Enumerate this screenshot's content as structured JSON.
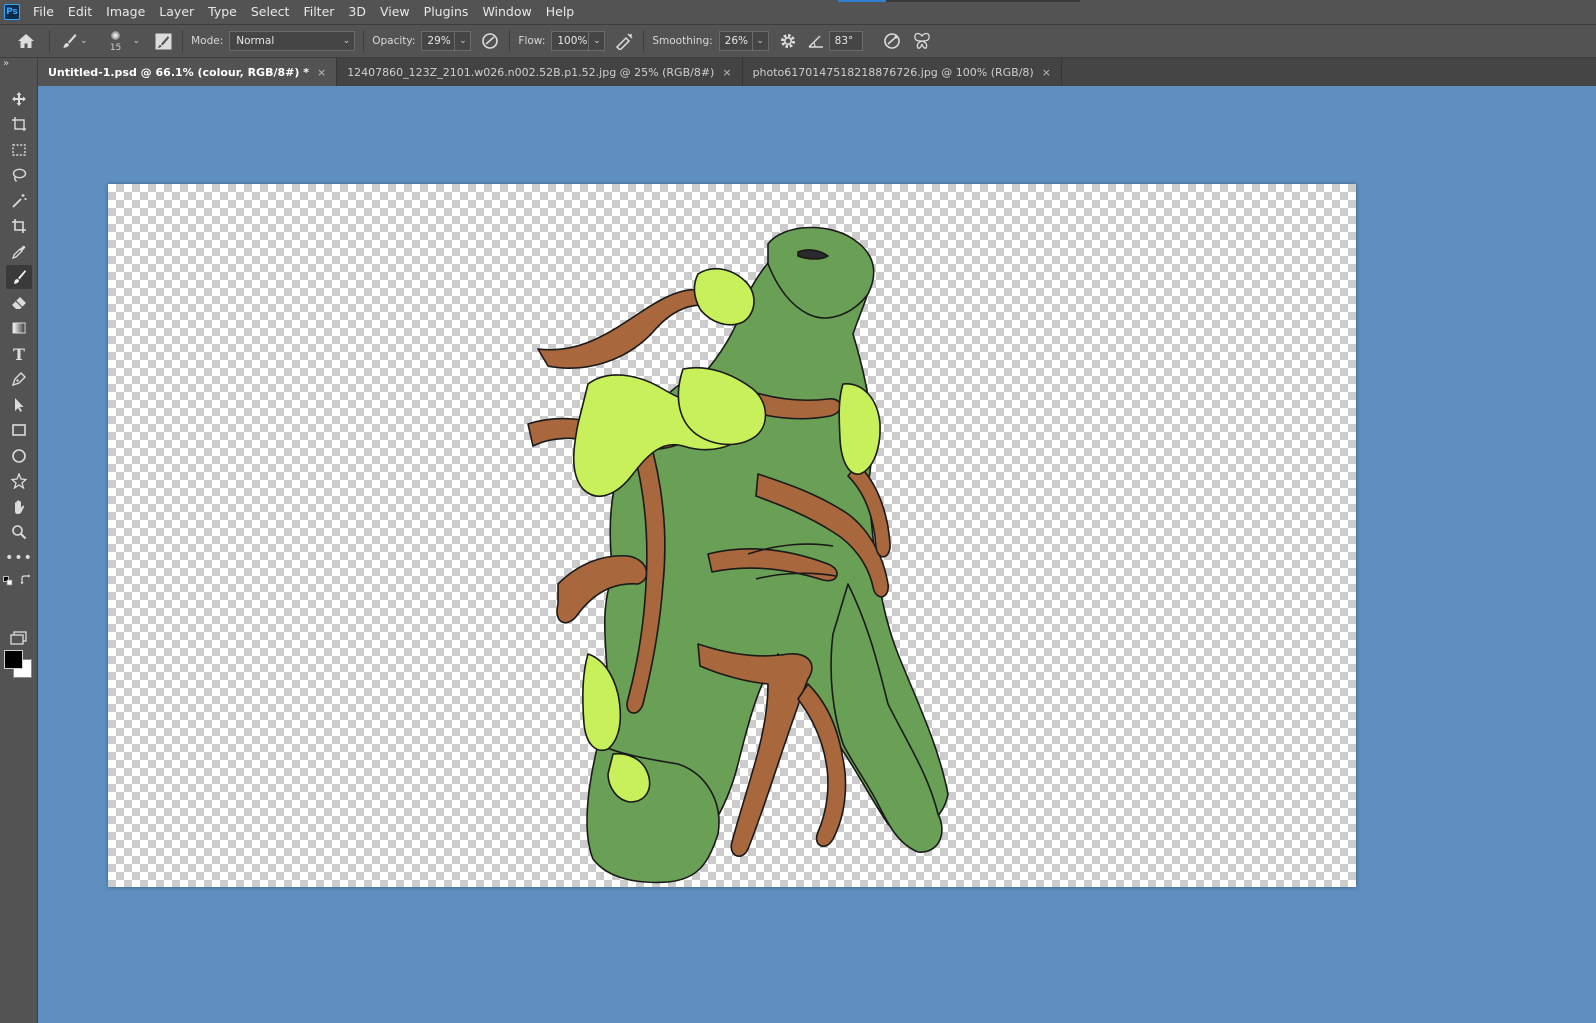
{
  "app": {
    "logo_text": "Ps"
  },
  "menu": [
    "File",
    "Edit",
    "Image",
    "Layer",
    "Type",
    "Select",
    "Filter",
    "3D",
    "View",
    "Plugins",
    "Window",
    "Help"
  ],
  "options": {
    "brush_size": "15",
    "mode_label": "Mode:",
    "mode_value": "Normal",
    "opacity_label": "Opacity:",
    "opacity_value": "29%",
    "flow_label": "Flow:",
    "flow_value": "100%",
    "smoothing_label": "Smoothing:",
    "smoothing_value": "26%",
    "angle_value": "83°"
  },
  "tabs": [
    {
      "label": "Untitled-1.psd @ 66.1% (colour, RGB/8#) *",
      "active": true
    },
    {
      "label": "12407860_123Z_2101.w026.n002.52B.p1.52.jpg @ 25% (RGB/8#)",
      "active": false
    },
    {
      "label": "photo6170147518218876726.jpg @ 100% (RGB/8)",
      "active": false
    }
  ],
  "tools": [
    "move-tool",
    "artboard-tool",
    "marquee-tool",
    "lasso-tool",
    "magic-wand-tool",
    "crop-tool",
    "eyedropper-tool",
    "brush-tool",
    "eraser-tool",
    "gradient-tool",
    "type-tool",
    "pen-tool",
    "path-select-tool",
    "rectangle-tool",
    "ellipse-tool",
    "custom-shape-tool",
    "hand-tool",
    "zoom-tool",
    "more-tools"
  ],
  "colors": {
    "foreground": "#000000",
    "background": "#ffffff",
    "workspace": "#5f8fc0",
    "skin": "#6aa055",
    "moss": "#c8f05a",
    "roots": "#a8673c"
  }
}
